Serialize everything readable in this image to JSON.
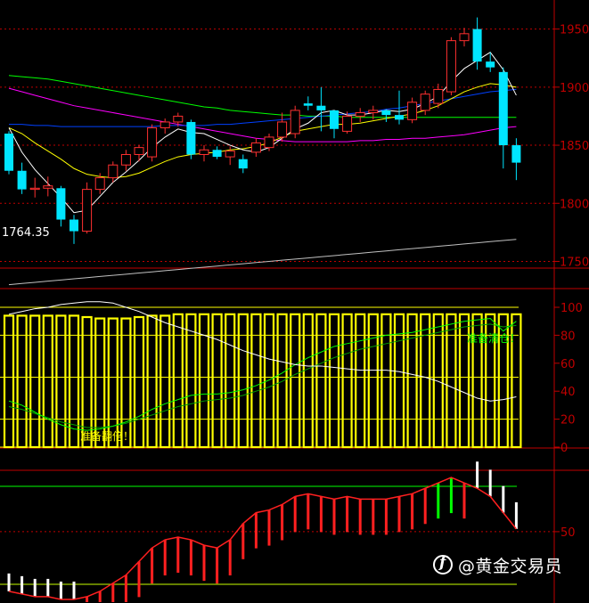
{
  "chart_data": [
    {
      "type": "candlestick",
      "panel": "price",
      "ylim": [
        1745,
        1975
      ],
      "yticks": [
        1750,
        1800,
        1850,
        1900,
        1950
      ],
      "annotation_low": "1764.35",
      "colors": {
        "up": "#ff3030",
        "down": "#00e5ff",
        "ma_white": "#ffffff",
        "ma_yellow": "#ffff00",
        "ma_magenta": "#ff00ff",
        "ma_green": "#00ff00",
        "ma_blue": "#0040ff",
        "ma_gray": "#c0c0c0"
      },
      "candles": [
        [
          1860,
          1862,
          1825,
          1828
        ],
        [
          1828,
          1835,
          1808,
          1812
        ],
        [
          1812,
          1822,
          1805,
          1813
        ],
        [
          1813,
          1823,
          1806,
          1815
        ],
        [
          1813,
          1815,
          1780,
          1786
        ],
        [
          1786,
          1790,
          1765,
          1776
        ],
        [
          1776,
          1818,
          1774,
          1812
        ],
        [
          1812,
          1826,
          1808,
          1822
        ],
        [
          1822,
          1836,
          1818,
          1833
        ],
        [
          1833,
          1846,
          1828,
          1842
        ],
        [
          1842,
          1850,
          1836,
          1848
        ],
        [
          1840,
          1868,
          1836,
          1865
        ],
        [
          1865,
          1873,
          1860,
          1870
        ],
        [
          1870,
          1878,
          1866,
          1875
        ],
        [
          1870,
          1872,
          1838,
          1842
        ],
        [
          1842,
          1850,
          1836,
          1846
        ],
        [
          1846,
          1849,
          1838,
          1840
        ],
        [
          1840,
          1849,
          1833,
          1845
        ],
        [
          1838,
          1842,
          1826,
          1830
        ],
        [
          1844,
          1856,
          1840,
          1852
        ],
        [
          1848,
          1860,
          1845,
          1857
        ],
        [
          1857,
          1878,
          1853,
          1870
        ],
        [
          1860,
          1884,
          1856,
          1880
        ],
        [
          1886,
          1892,
          1880,
          1884
        ],
        [
          1884,
          1900,
          1862,
          1880
        ],
        [
          1880,
          1880,
          1856,
          1864
        ],
        [
          1862,
          1879,
          1860,
          1875
        ],
        [
          1875,
          1882,
          1870,
          1878
        ],
        [
          1878,
          1884,
          1872,
          1880
        ],
        [
          1880,
          1881,
          1870,
          1876
        ],
        [
          1876,
          1897,
          1868,
          1872
        ],
        [
          1872,
          1891,
          1869,
          1887
        ],
        [
          1880,
          1897,
          1876,
          1894
        ],
        [
          1886,
          1903,
          1882,
          1898
        ],
        [
          1896,
          1943,
          1893,
          1940
        ],
        [
          1940,
          1951,
          1935,
          1946
        ],
        [
          1950,
          1960,
          1915,
          1922
        ],
        [
          1922,
          1930,
          1913,
          1917
        ],
        [
          1913,
          1917,
          1830,
          1850
        ],
        [
          1850,
          1856,
          1820,
          1835
        ]
      ],
      "ma_white": [
        1865,
        1844,
        1829,
        1817,
        1805,
        1792,
        1794,
        1806,
        1818,
        1827,
        1837,
        1848,
        1857,
        1864,
        1861,
        1860,
        1855,
        1850,
        1846,
        1844,
        1848,
        1856,
        1864,
        1869,
        1878,
        1880,
        1876,
        1876,
        1878,
        1880,
        1879,
        1881,
        1886,
        1892,
        1905,
        1916,
        1923,
        1930,
        1915,
        1893
      ],
      "ma_yellow": [
        1865,
        1860,
        1852,
        1845,
        1838,
        1830,
        1825,
        1823,
        1822,
        1823,
        1826,
        1831,
        1836,
        1840,
        1842,
        1843,
        1844,
        1846,
        1847,
        1849,
        1852,
        1857,
        1862,
        1864,
        1866,
        1868,
        1868,
        1869,
        1871,
        1873,
        1875,
        1877,
        1880,
        1884,
        1890,
        1896,
        1900,
        1903,
        1902,
        1900
      ],
      "ma_magenta": [
        1899,
        1896,
        1893,
        1890,
        1887,
        1884,
        1882,
        1880,
        1878,
        1876,
        1874,
        1872,
        1870,
        1868,
        1866,
        1864,
        1862,
        1860,
        1858,
        1856,
        1855,
        1854,
        1853,
        1853,
        1853,
        1853,
        1853,
        1854,
        1854,
        1855,
        1855,
        1856,
        1856,
        1857,
        1858,
        1859,
        1861,
        1863,
        1865,
        1866
      ],
      "ma_green": [
        1910,
        1909,
        1908,
        1907,
        1905,
        1903,
        1901,
        1899,
        1897,
        1895,
        1893,
        1891,
        1889,
        1887,
        1885,
        1883,
        1882,
        1880,
        1879,
        1878,
        1877,
        1876,
        1876,
        1875,
        1875,
        1875,
        1874,
        1874,
        1874,
        1874,
        1874,
        1874,
        1874,
        1874,
        1874,
        1874,
        1874,
        1874,
        1874,
        1874
      ],
      "ma_blue": [
        1868,
        1868,
        1867,
        1867,
        1866,
        1866,
        1866,
        1866,
        1866,
        1866,
        1866,
        1866,
        1867,
        1867,
        1867,
        1867,
        1868,
        1868,
        1869,
        1870,
        1871,
        1872,
        1873,
        1874,
        1875,
        1876,
        1877,
        1878,
        1879,
        1881,
        1882,
        1884,
        1886,
        1888,
        1890,
        1892,
        1894,
        1896,
        1897,
        1898
      ],
      "ma_gray": [
        1730,
        1731,
        1732,
        1733,
        1734,
        1735,
        1736,
        1737,
        1738,
        1739,
        1740,
        1741,
        1742,
        1743,
        1744,
        1745,
        1746,
        1747,
        1748,
        1749,
        1750,
        1751,
        1752,
        1753,
        1754,
        1755,
        1756,
        1757,
        1758,
        1759,
        1760,
        1761,
        1762,
        1763,
        1764,
        1765,
        1766,
        1767,
        1768,
        1769
      ]
    },
    {
      "type": "bar",
      "panel": "oscillator",
      "ylim": [
        0,
        100
      ],
      "yticks": [
        0,
        20,
        40,
        60,
        80,
        100
      ],
      "reference_levels": [
        0,
        20,
        50,
        80,
        100
      ],
      "bars_values": [
        94,
        94,
        94,
        94,
        94,
        94,
        93,
        92,
        92,
        92,
        93,
        94,
        94,
        95,
        95,
        95,
        95,
        95,
        95,
        95,
        95,
        95,
        95,
        95,
        95,
        95,
        95,
        95,
        95,
        95,
        95,
        95,
        95,
        95,
        95,
        95,
        95,
        95,
        95,
        95
      ],
      "line_white": [
        95,
        97,
        99,
        100,
        102,
        103,
        104,
        104,
        103,
        100,
        97,
        93,
        89,
        86,
        83,
        80,
        77,
        73,
        69,
        66,
        63,
        61,
        59,
        58,
        58,
        57,
        56,
        55,
        55,
        55,
        54,
        52,
        50,
        47,
        43,
        39,
        35,
        33,
        34,
        36
      ],
      "line_green_bright": [
        33,
        30,
        25,
        20,
        16,
        13,
        12,
        13,
        15,
        18,
        22,
        27,
        31,
        34,
        37,
        38,
        38,
        39,
        41,
        44,
        48,
        53,
        59,
        64,
        68,
        72,
        74,
        76,
        78,
        80,
        81,
        82,
        84,
        86,
        88,
        90,
        91,
        92,
        83,
        90
      ],
      "line_green_dark": [
        29,
        27,
        24,
        21,
        18,
        16,
        14,
        14,
        15,
        17,
        20,
        23,
        26,
        29,
        31,
        33,
        34,
        35,
        37,
        40,
        43,
        47,
        52,
        56,
        60,
        64,
        67,
        70,
        72,
        74,
        76,
        78,
        80,
        82,
        84,
        86,
        87,
        88,
        86,
        87
      ],
      "signal_low_text": "准备翻倍！",
      "signal_high_text": "准备清仓！"
    },
    {
      "type": "bar",
      "panel": "macd-like",
      "yticks": [
        50
      ],
      "reference_levels": [
        50
      ],
      "ylim": [
        24,
        72
      ],
      "hist_values": [
        28,
        27,
        26,
        26,
        25,
        25,
        26,
        28,
        31,
        34,
        39,
        44,
        47,
        48,
        47,
        45,
        44,
        47,
        53,
        57,
        58,
        60,
        63,
        64,
        63,
        62,
        63,
        62,
        62,
        62,
        63,
        64,
        66,
        68,
        70,
        68,
        66,
        63,
        57,
        51
      ],
      "hist_colors": [
        "white",
        "white",
        "white",
        "white",
        "white",
        "white",
        "red",
        "red",
        "red",
        "red",
        "red",
        "red",
        "red",
        "red",
        "red",
        "red",
        "red",
        "red",
        "red",
        "red",
        "red",
        "red",
        "red",
        "red",
        "red",
        "red",
        "red",
        "red",
        "red",
        "red",
        "red",
        "red",
        "red",
        "green",
        "green",
        "red",
        "white",
        "white",
        "white",
        "white"
      ]
    }
  ],
  "watermark": {
    "handle": "@黄金交易员"
  }
}
